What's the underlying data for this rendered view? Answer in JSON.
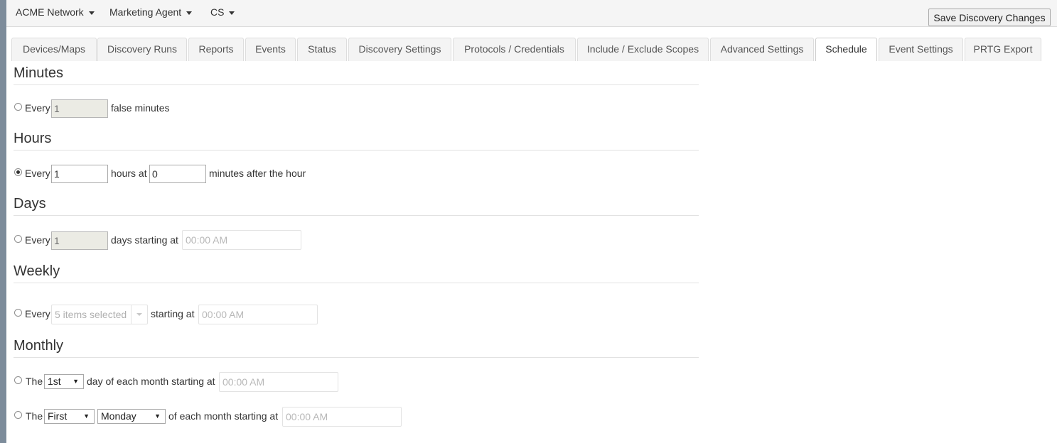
{
  "topbar": {
    "network": "ACME Network",
    "agent": "Marketing Agent",
    "user": "CS",
    "save_label": "Save Discovery Changes"
  },
  "tabs": [
    {
      "label": "Devices/Maps"
    },
    {
      "label": "Discovery Runs"
    },
    {
      "label": "Reports"
    },
    {
      "label": "Events"
    },
    {
      "label": "Status"
    },
    {
      "label": "Discovery Settings"
    },
    {
      "label": "Protocols / Credentials"
    },
    {
      "label": "Include / Exclude Scopes"
    },
    {
      "label": "Advanced Settings"
    },
    {
      "label": "Schedule",
      "active": true
    },
    {
      "label": "Event Settings"
    },
    {
      "label": "PRTG Export"
    }
  ],
  "schedule": {
    "minutes": {
      "title": "Minutes",
      "selected": false,
      "every": "Every",
      "value": "1",
      "suffix": "false minutes"
    },
    "hours": {
      "title": "Hours",
      "selected": true,
      "every": "Every",
      "value": "1",
      "mid": "hours at",
      "minute_value": "0",
      "suffix": "minutes after the hour"
    },
    "days": {
      "title": "Days",
      "selected": false,
      "every": "Every",
      "value": "1",
      "mid": "days starting at",
      "time_placeholder": "00:00 AM"
    },
    "weekly": {
      "title": "Weekly",
      "selected": false,
      "every": "Every",
      "days_selected": "5 items selected",
      "mid": "starting at",
      "time_placeholder": "00:00 AM"
    },
    "monthly": {
      "title": "Monthly",
      "option1": {
        "selected": false,
        "prefix": "The",
        "day": "1st",
        "mid": "day of each month starting at",
        "time_placeholder": "00:00 AM"
      },
      "option2": {
        "selected": false,
        "prefix": "The",
        "ordinal": "First",
        "weekday": "Monday",
        "mid": "of each month starting at",
        "time_placeholder": "00:00 AM"
      }
    }
  }
}
